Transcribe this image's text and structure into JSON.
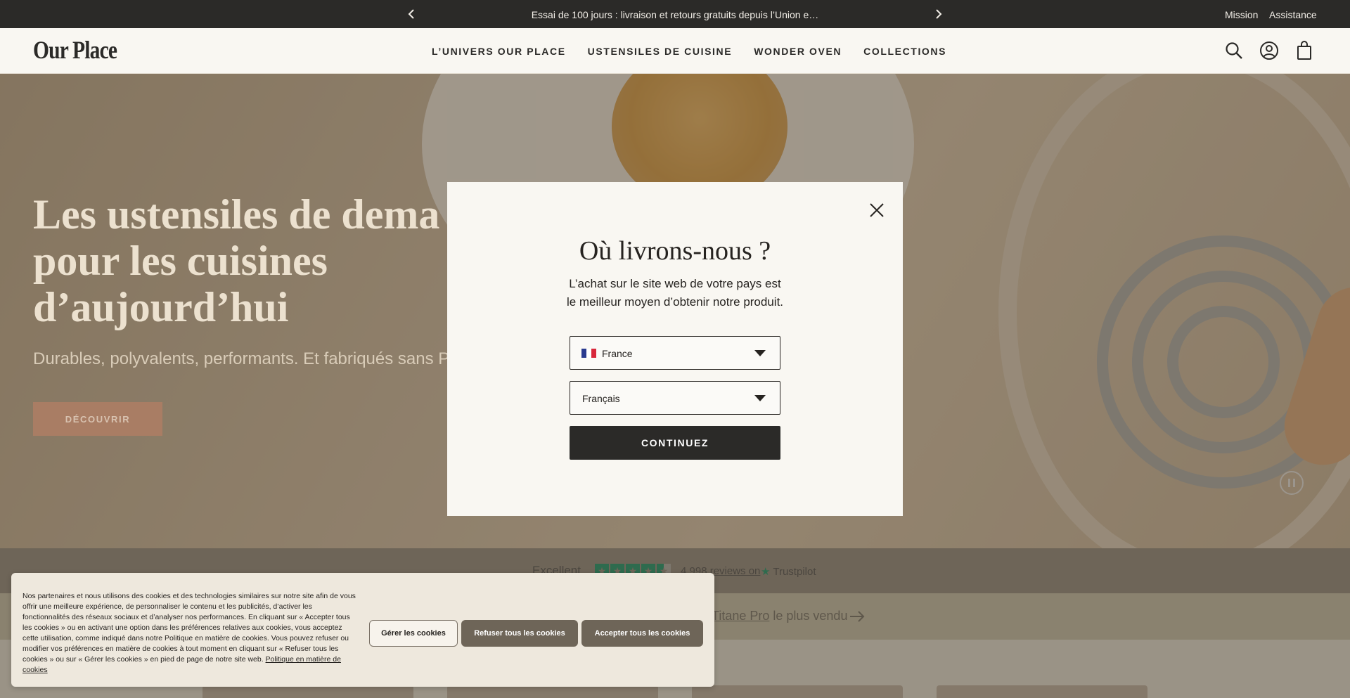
{
  "announcement": {
    "message": "Essai de 100 jours : livraison et retours gratuits depuis l’Union e…",
    "links": [
      "Mission",
      "Assistance"
    ]
  },
  "header": {
    "logo": "Our Place",
    "nav": [
      "L’UNIVERS OUR PLACE",
      "USTENSILES DE CUISINE",
      "WONDER OVEN",
      "COLLECTIONS"
    ]
  },
  "hero": {
    "title_lines": [
      "Les ustensiles de dema",
      "pour les cuisines",
      "d’aujourd’hui"
    ],
    "subtitle": "Durables, polyvalents, performants. Et fabriqués sans P",
    "cta": "DÉCOUVRIR"
  },
  "trust": {
    "rating": "Excellent",
    "reviews": "4,998 reviews on",
    "brand": "Trustpilot",
    "stars": 4.5
  },
  "promo": {
    "link": "Titane Pro",
    "text": " le plus vendu"
  },
  "modal": {
    "title": "Où livrons-nous ?",
    "description_line1": "L’achat sur le site web de votre pays est",
    "description_line2": "le meilleur moyen d’obtenir notre produit.",
    "country_value": "France",
    "language_value": "Français",
    "continue_label": "CONTINUEZ"
  },
  "cookie": {
    "text": "Nos partenaires et nous utilisons des cookies et des technologies similaires sur notre site afin de vous offrir une meilleure expérience, de personnaliser le contenu et les publicités, d’activer les fonctionnalités des réseaux sociaux et d’analyser nos performances. En cliquant sur « Accepter tous les cookies » ou en activant une option dans les préférences relatives aux cookies, vous acceptez cette utilisation, comme indiqué dans notre Politique en matière de cookies. Vous pouvez refuser ou modifier vos préférences en matière de cookies à tout moment en cliquant sur « Refuser tous les cookies » ou sur « Gérer les cookies » en pied de page de notre site web.",
    "policy_link": "Politique en matière de cookies",
    "manage_label": "Gérer les cookies",
    "refuse_label": "Refuser tous les cookies",
    "accept_label": "Accepter tous les cookies"
  },
  "colors": {
    "announcement_bg": "#2b2a28",
    "button_dark": "#2b2a28",
    "cookie_button": "#6e6558",
    "trustpilot_green": "#00b67a"
  }
}
